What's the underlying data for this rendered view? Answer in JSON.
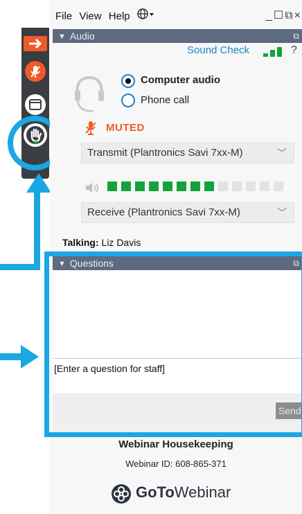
{
  "menu": {
    "file": "File",
    "view": "View",
    "help": "Help",
    "globe_icon": "globe-icon",
    "window_controls": "_☐⧉×"
  },
  "audio": {
    "section_title": "Audio",
    "sound_check": "Sound Check",
    "help": "?",
    "computer_audio": "Computer audio",
    "phone_call": "Phone call",
    "selected_mode": "Computer audio",
    "muted_status": "MUTED",
    "transmit_select": "Transmit (Plantronics Savi 7xx-M)",
    "receive_select": "Receive (Plantronics Savi 7xx-M)",
    "signal_bars": 3,
    "meter_level_filled": 8,
    "meter_level_total": 13
  },
  "talking": {
    "label": "Talking:",
    "name": "Liz Davis"
  },
  "questions": {
    "section_title": "Questions",
    "input_placeholder": "[Enter a question for staff]",
    "send_button": "Send"
  },
  "footer": {
    "title": "Webinar Housekeeping",
    "webinar_id": "Webinar ID: 608-865-371",
    "brand_goto": "GoTo",
    "brand_webinar": "Webinar"
  },
  "colors": {
    "accent_orange": "#f05a28",
    "highlight_blue": "#1aa7e2",
    "section_bar": "#5d6a7f",
    "meter_green": "#14a23b",
    "link_blue": "#1a83c7"
  }
}
